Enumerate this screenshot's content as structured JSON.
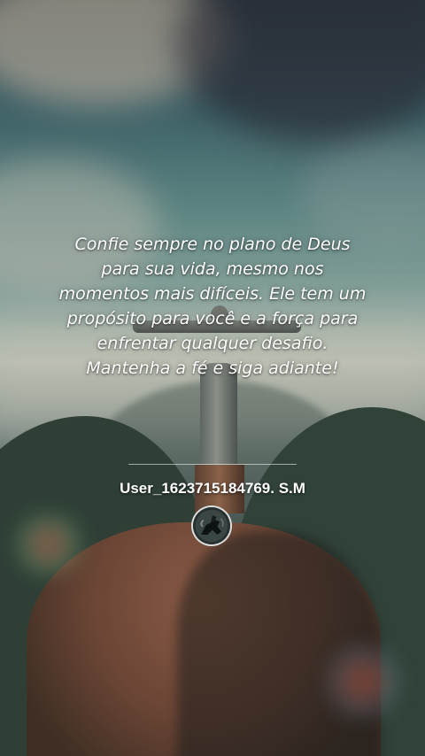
{
  "quote": {
    "lines": [
      "Confie sempre no plano de Deus",
      "para sua vida, mesmo nos",
      "momentos mais difíceis. Ele tem um",
      "propósito para você e a força para",
      "enfrentar qualquer desafio.",
      "Mantenha a fé e siga adiante!"
    ]
  },
  "author": {
    "username": "User_1623715184769. S.M",
    "avatar_icon": "horse-rider-avatar-icon"
  },
  "background": {
    "scene": "christ-the-redeemer-mountain-icon"
  }
}
